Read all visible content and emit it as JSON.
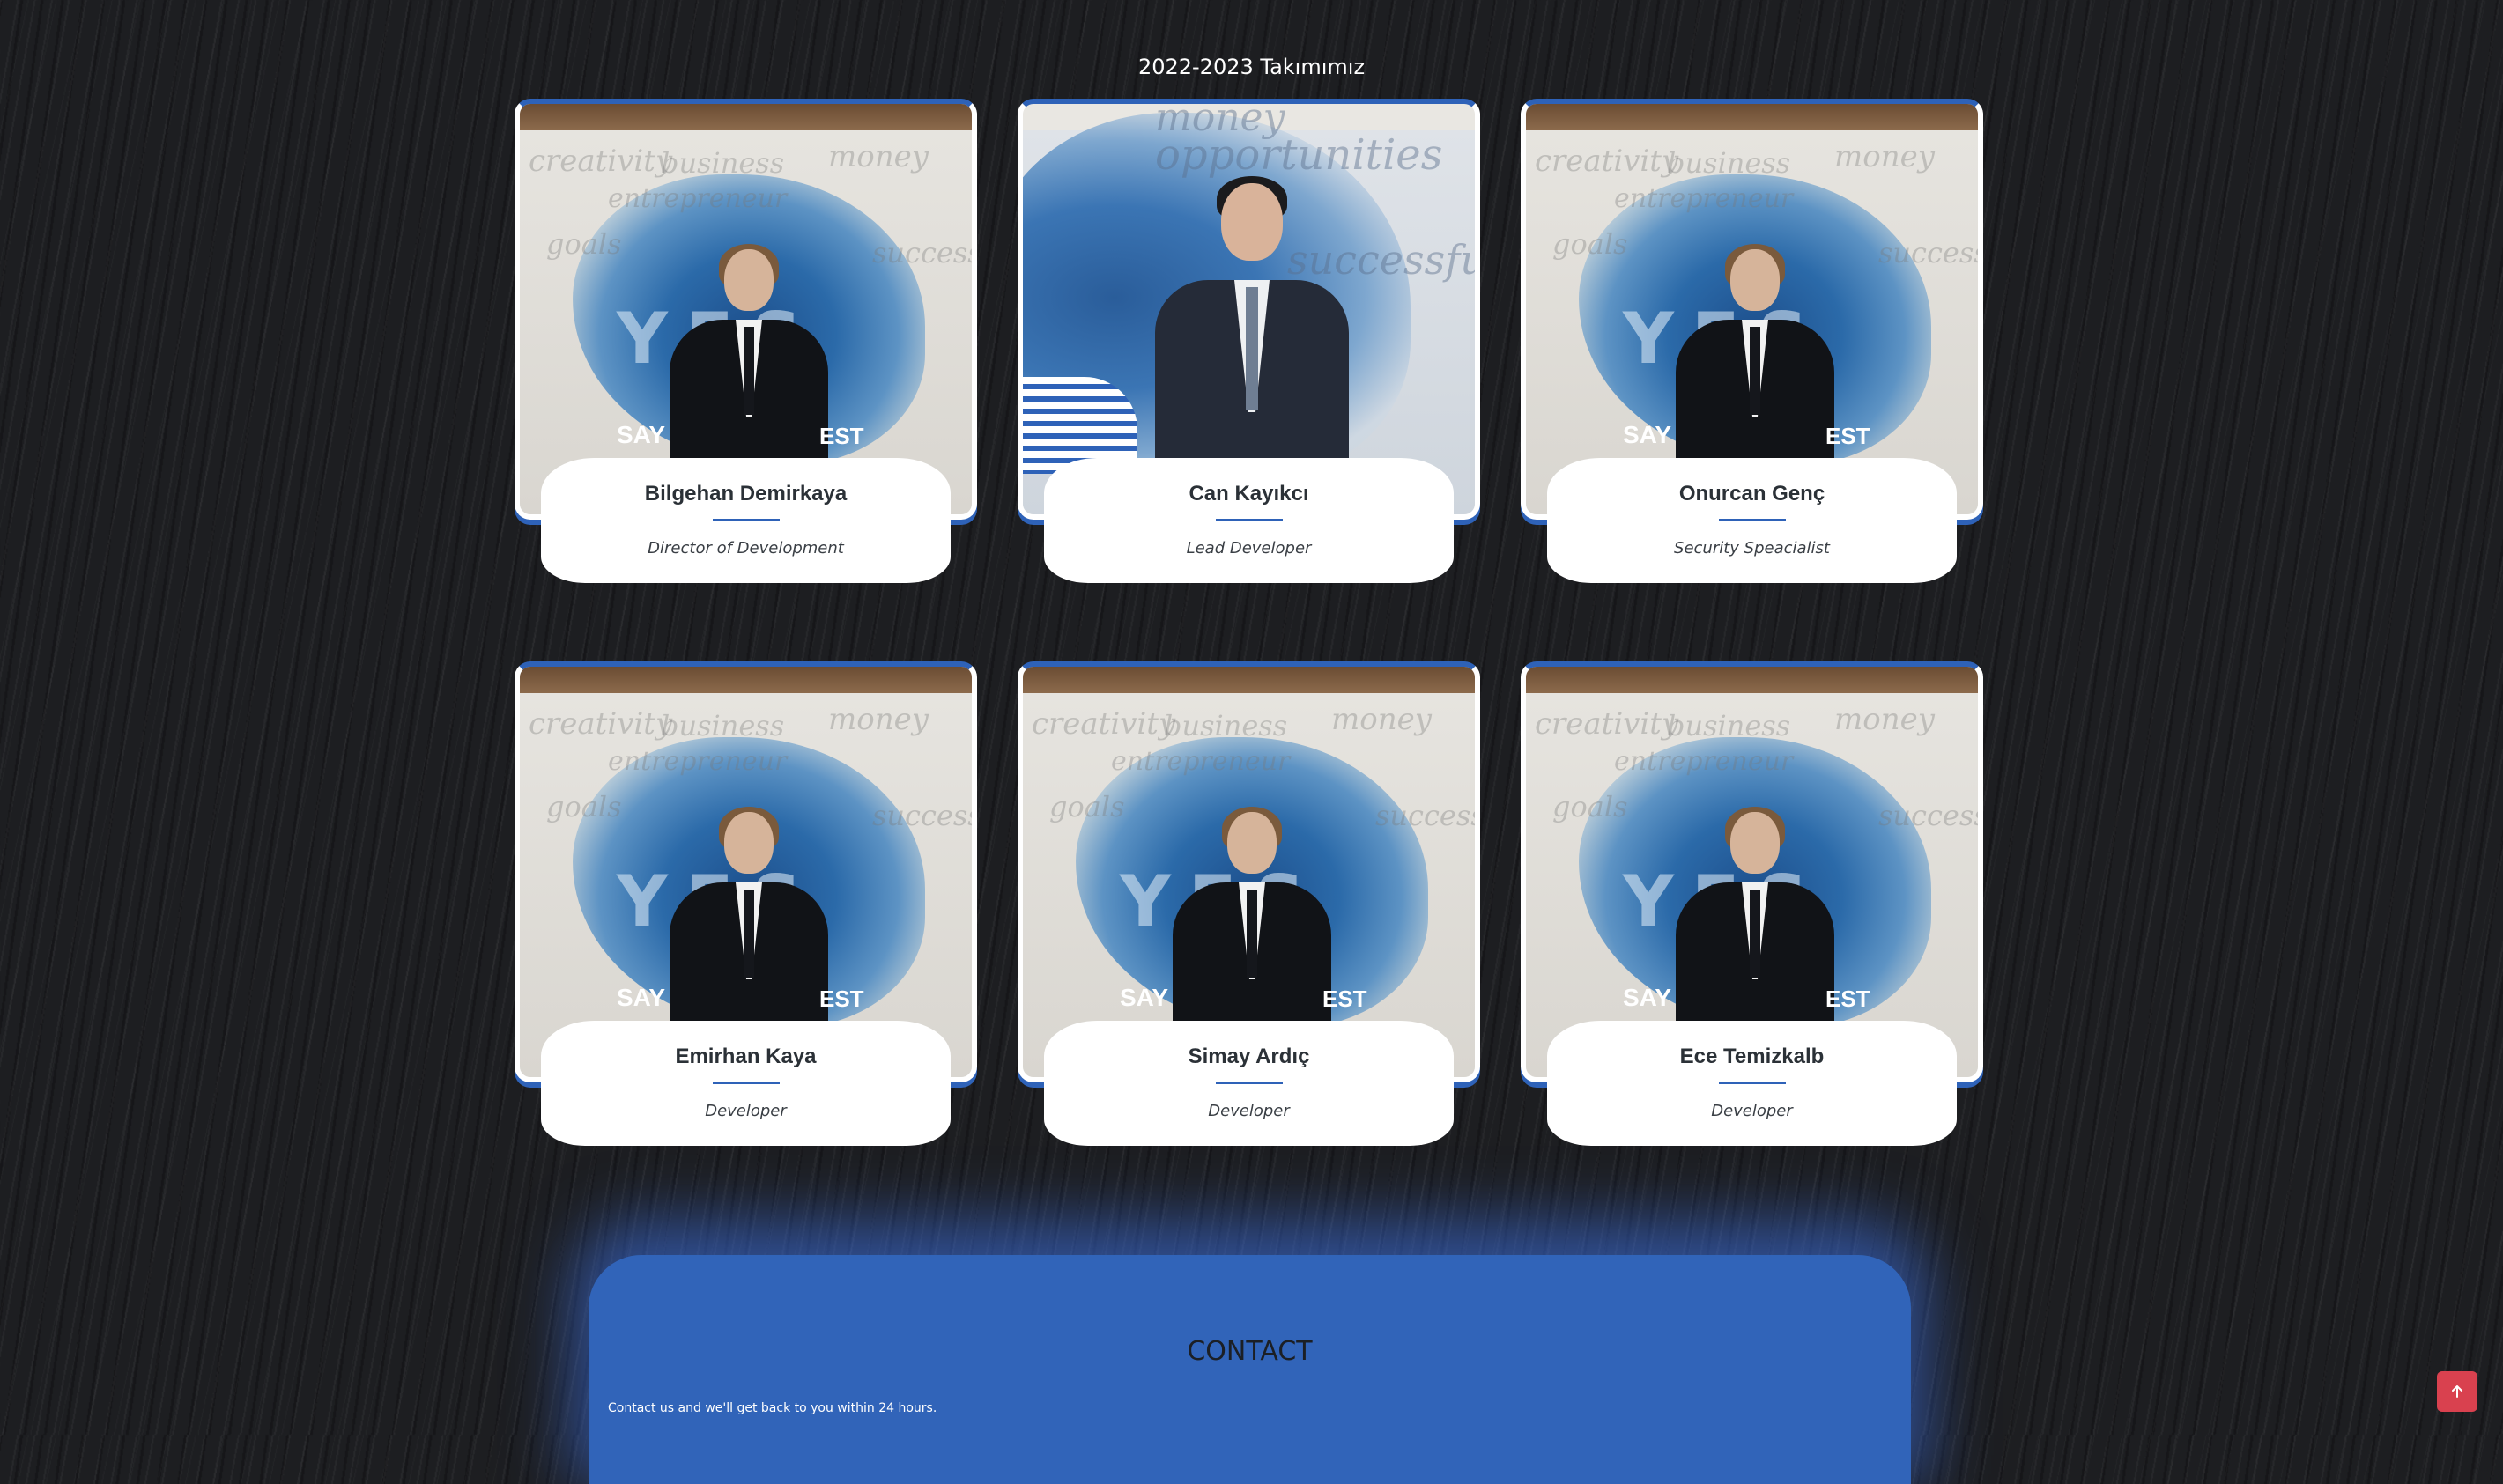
{
  "team": {
    "title": "2022-2023 Takımımız",
    "members": [
      {
        "name": "Bilgehan Demirkaya",
        "role": "Director of Development"
      },
      {
        "name": "Can Kayıkcı",
        "role": "Lead Developer"
      },
      {
        "name": "Onurcan Genç",
        "role": "Security Speacialist"
      },
      {
        "name": "Emirhan Kaya",
        "role": "Developer"
      },
      {
        "name": "Simay Ardıç",
        "role": "Developer"
      },
      {
        "name": "Ece Temizkalb",
        "role": "Developer"
      }
    ]
  },
  "contact": {
    "title": "CONTACT",
    "subtitle": "Contact us and we'll get back to you within 24 hours."
  },
  "back_to_top": {
    "icon": "arrow-up-icon"
  },
  "colors": {
    "accent": "#2e62b8",
    "contact_bg": "#3164b9",
    "back_to_top_bg": "#d9414f",
    "page_bg": "#1d1e21"
  }
}
